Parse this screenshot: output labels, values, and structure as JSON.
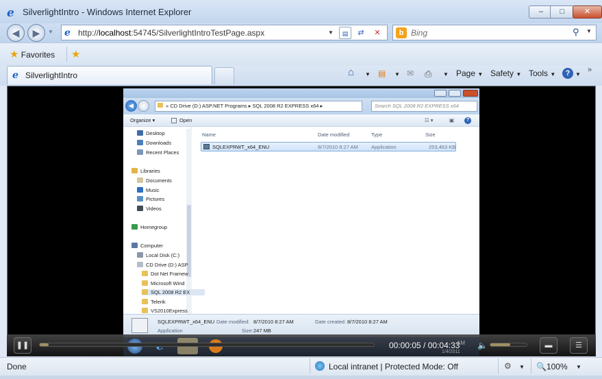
{
  "window": {
    "title": "SilverlightIntro - Windows Internet Explorer",
    "minimize": "–",
    "maximize": "□",
    "close": "✕"
  },
  "address_bar": {
    "url_prefix": "http://",
    "url_domain": "localhost",
    "url_rest": ":54745/SilverlightIntroTestPage.aspx"
  },
  "search": {
    "provider": "b",
    "placeholder": "Bing"
  },
  "favorites": {
    "label": "Favorites"
  },
  "tab": {
    "label": "SilverlightIntro"
  },
  "command_bar": {
    "page": "Page",
    "safety": "Safety",
    "tools": "Tools",
    "more": "»"
  },
  "explorer": {
    "breadcrumb_prefix": "«",
    "breadcrumb": [
      "CD Drive (D:) ASP.NET Programs",
      "SQL 2008 R2 EXPRESS x64"
    ],
    "search_placeholder": "Search SQL 2008 R2 EXPRESS x64",
    "organize": "Organize ▾",
    "open": "Open",
    "nav_items": [
      {
        "label": "Desktop",
        "icon": "desktop-icon",
        "color": "#3f6ea6"
      },
      {
        "label": "Downloads",
        "icon": "downloads-icon",
        "color": "#4a7fb9"
      },
      {
        "label": "Recent Places",
        "icon": "recent-icon",
        "color": "#7a96b8"
      },
      {
        "label": "Libraries",
        "icon": "library-icon",
        "color": "#e1b548"
      },
      {
        "label": "Documents",
        "icon": "documents-icon",
        "color": "#d3c6a0"
      },
      {
        "label": "Music",
        "icon": "music-icon",
        "color": "#2f6ec1"
      },
      {
        "label": "Pictures",
        "icon": "pictures-icon",
        "color": "#5a8fc6"
      },
      {
        "label": "Videos",
        "icon": "videos-icon",
        "color": "#444b57"
      },
      {
        "label": "Homegroup",
        "icon": "homegroup-icon",
        "color": "#3b9a4b"
      },
      {
        "label": "Computer",
        "icon": "computer-icon",
        "color": "#5b7aa3"
      },
      {
        "label": "Local Disk (C:)",
        "icon": "disk-icon",
        "color": "#8a97a8"
      },
      {
        "label": "CD Drive (D:) ASP",
        "icon": "cd-drive-icon",
        "color": "#b4bcc6"
      },
      {
        "label": "Dot Net Framew",
        "icon": "folder-icon",
        "color": "#e8c15a"
      },
      {
        "label": "Microsoft Wind",
        "icon": "folder-icon",
        "color": "#e8c15a"
      },
      {
        "label": "SQL 2008 R2 EX",
        "icon": "folder-icon",
        "color": "#e8c15a"
      },
      {
        "label": "Telerik",
        "icon": "folder-icon",
        "color": "#e8c15a"
      },
      {
        "label": "VS2010Express",
        "icon": "folder-icon",
        "color": "#e8c15a"
      }
    ],
    "columns": [
      "Name",
      "Date modified",
      "Type",
      "Size"
    ],
    "file": {
      "name": "SQLEXPRWT_x64_ENU",
      "date_modified": "8/7/2010 8:27 AM",
      "type": "Application",
      "size": "253,463 KB"
    },
    "details": {
      "name": "SQLEXPRWT_x64_ENU",
      "type": "Application",
      "date_modified_label": "Date modified:",
      "date_modified": "8/7/2010 8:27 AM",
      "size_label": "Size:",
      "size": "247 MB",
      "date_created_label": "Date created:",
      "date_created": "8/7/2010 8:27 AM"
    },
    "taskbar_time": "AM",
    "taskbar_date": "1/4/2011"
  },
  "player": {
    "pause": "❚❚",
    "time": "00:00:05 / 00:04:33",
    "progress_fraction": 0.018,
    "volume_fraction": 0.55,
    "captions": "▬",
    "menu": "☰"
  },
  "status": {
    "text": "Done",
    "zone": "Local intranet | Protected Mode: Off",
    "zoom": "100%"
  }
}
